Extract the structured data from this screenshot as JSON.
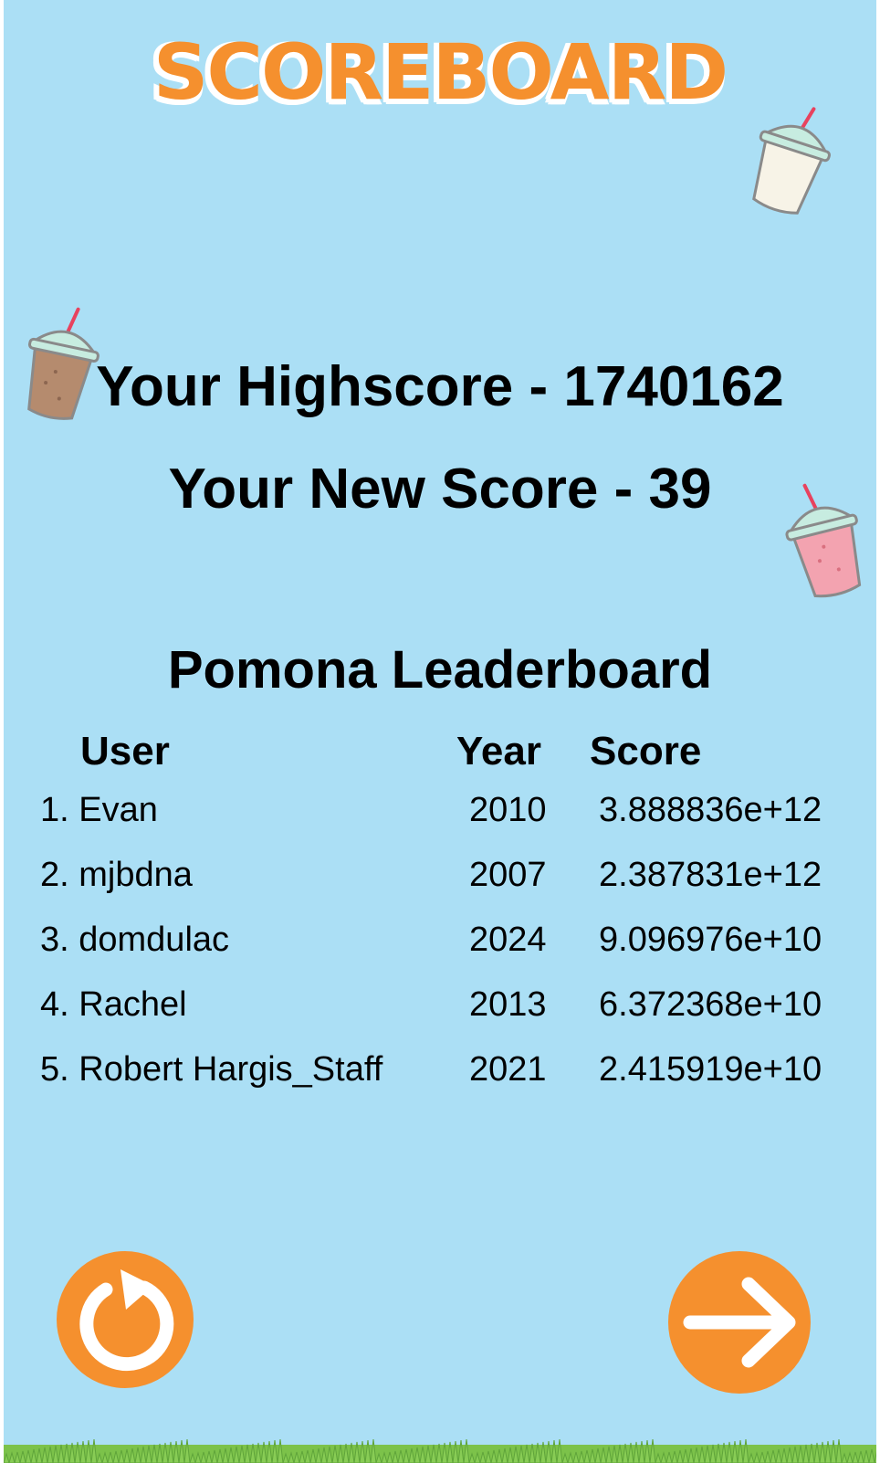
{
  "title": "SCOREBOARD",
  "highscore_text": "Your Highscore - 1740162",
  "newscore_text": "Your New Score - 39",
  "leaderboard": {
    "title": "Pomona Leaderboard",
    "headers": {
      "user": "User",
      "year": "Year",
      "score": "Score"
    },
    "rows": [
      {
        "user": "1. Evan",
        "year": "2010",
        "score": "3.888836e+12"
      },
      {
        "user": "2. mjbdna",
        "year": "2007",
        "score": "2.387831e+12"
      },
      {
        "user": "3. domdulac",
        "year": "2024",
        "score": "9.096976e+10"
      },
      {
        "user": "4. Rachel",
        "year": "2013",
        "score": "6.372368e+10"
      },
      {
        "user": "5. Robert Hargis_Staff",
        "year": "2021",
        "score": "2.415919e+10"
      }
    ]
  },
  "buttons": {
    "restart_icon": "restart-icon",
    "next_icon": "arrow-right-icon"
  },
  "decorations": {
    "cups": [
      "vanilla-drink-icon",
      "chocolate-drink-icon",
      "strawberry-drink-icon"
    ]
  },
  "colors": {
    "background": "#abdff5",
    "accent": "#f5902e",
    "text": "#000000"
  }
}
